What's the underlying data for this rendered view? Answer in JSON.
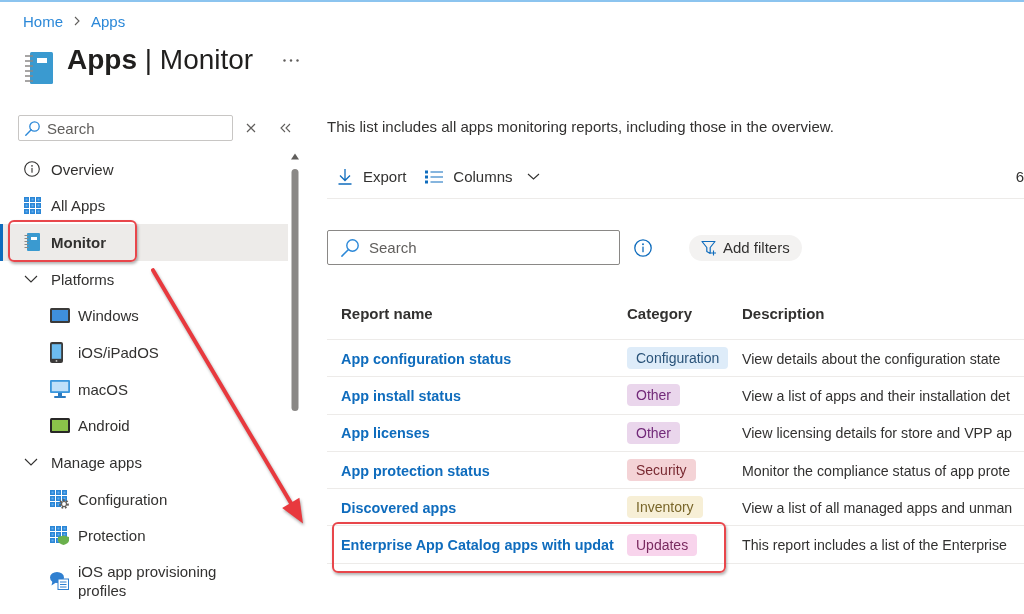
{
  "breadcrumb": [
    {
      "label": "Home"
    },
    {
      "label": "Apps"
    }
  ],
  "page": {
    "title": "**Apps** | Monitor"
  },
  "sidebar": {
    "search": {
      "placeholder": "Search"
    },
    "items": [
      {
        "kind": "link",
        "label": "Overview",
        "selected": false,
        "highlighted": false
      },
      {
        "kind": "link",
        "label": "All Apps",
        "selected": false,
        "highlighted": false
      },
      {
        "kind": "link",
        "label": "Monitor",
        "selected": true,
        "highlighted": true
      },
      {
        "kind": "group",
        "label": "Platforms",
        "expanded": true,
        "selected": false,
        "highlighted": false,
        "children": [
          {
            "kind": "link",
            "label": "Windows",
            "selected": false,
            "highlighted": false
          },
          {
            "kind": "link",
            "label": "iOS/iPadOS",
            "selected": false,
            "highlighted": false
          },
          {
            "kind": "link",
            "label": "macOS",
            "selected": false,
            "highlighted": false
          },
          {
            "kind": "link",
            "label": "Android",
            "selected": false,
            "highlighted": false
          }
        ]
      },
      {
        "kind": "group",
        "label": "Manage apps",
        "expanded": true,
        "selected": false,
        "highlighted": false,
        "children": [
          {
            "kind": "link",
            "label": "Configuration",
            "selected": false,
            "highlighted": false
          },
          {
            "kind": "link",
            "label": "Protection",
            "selected": false,
            "highlighted": false
          },
          {
            "kind": "link",
            "label": "iOS app provisioning profiles",
            "selected": false,
            "highlighted": false
          }
        ]
      }
    ]
  },
  "main": {
    "intro": "This list includes all apps monitoring reports, including those in the overview.",
    "toolbar": {
      "buttons": [
        {
          "kind": "action",
          "label": "Export"
        },
        {
          "kind": "dropdown",
          "label": "Columns"
        }
      ],
      "trailing_text": "6"
    },
    "search": {
      "placeholder": "Search"
    },
    "filter_button": {
      "label": "Add filters"
    }
  },
  "table": {
    "columns": [
      "Report name",
      "Category",
      "Description"
    ],
    "rows": [
      {
        "name": "App configuration status",
        "category": "Configuration",
        "color": "#deecf9",
        "description": "View details about the configuration state",
        "highlighted": false
      },
      {
        "name": "App install status",
        "category": "Other",
        "color": "#ead6ec",
        "description": "View a list of apps and their installation det",
        "highlighted": false
      },
      {
        "name": "App licenses",
        "category": "Other",
        "color": "#ead6ec",
        "description": "View licensing details for store and VPP ap",
        "highlighted": false
      },
      {
        "name": "App protection status",
        "category": "Security",
        "color": "#f4d3d6",
        "description": "Monitor the compliance status of app prote",
        "highlighted": false
      },
      {
        "name": "Discovered apps",
        "category": "Inventory",
        "color": "#f7efd6",
        "description": "View a list of all managed apps and unman",
        "highlighted": false
      },
      {
        "name": "Enterprise App Catalog apps with updat",
        "category": "Updates",
        "color": "#f8d4ec",
        "description": "This report includes a list of the Enterprise",
        "highlighted": true
      }
    ]
  },
  "annotations": [
    {
      "kind": "arrow"
    }
  ]
}
